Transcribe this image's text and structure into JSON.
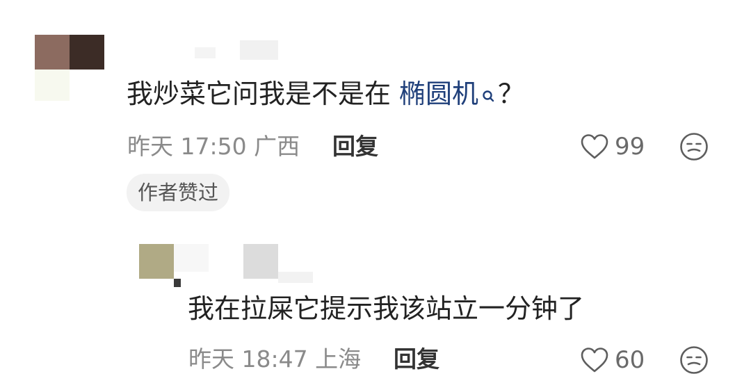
{
  "comment1": {
    "text_prefix": "我炒菜它问我是不是在",
    "keyword": "椭圆机",
    "text_suffix": "？",
    "time": "昨天 17:50",
    "location": "广西",
    "reply_label": "回复",
    "likes": "99",
    "badge": "作者赞过"
  },
  "comment2": {
    "text": "我在拉屎它提示我该站立一分钟了",
    "time": "昨天 18:47",
    "location": "上海",
    "reply_label": "回复",
    "likes": "60"
  },
  "colors": {
    "keyword": "#1f3f7a",
    "meta": "#8a8a8a",
    "badge_bg": "#f2f2f2"
  }
}
